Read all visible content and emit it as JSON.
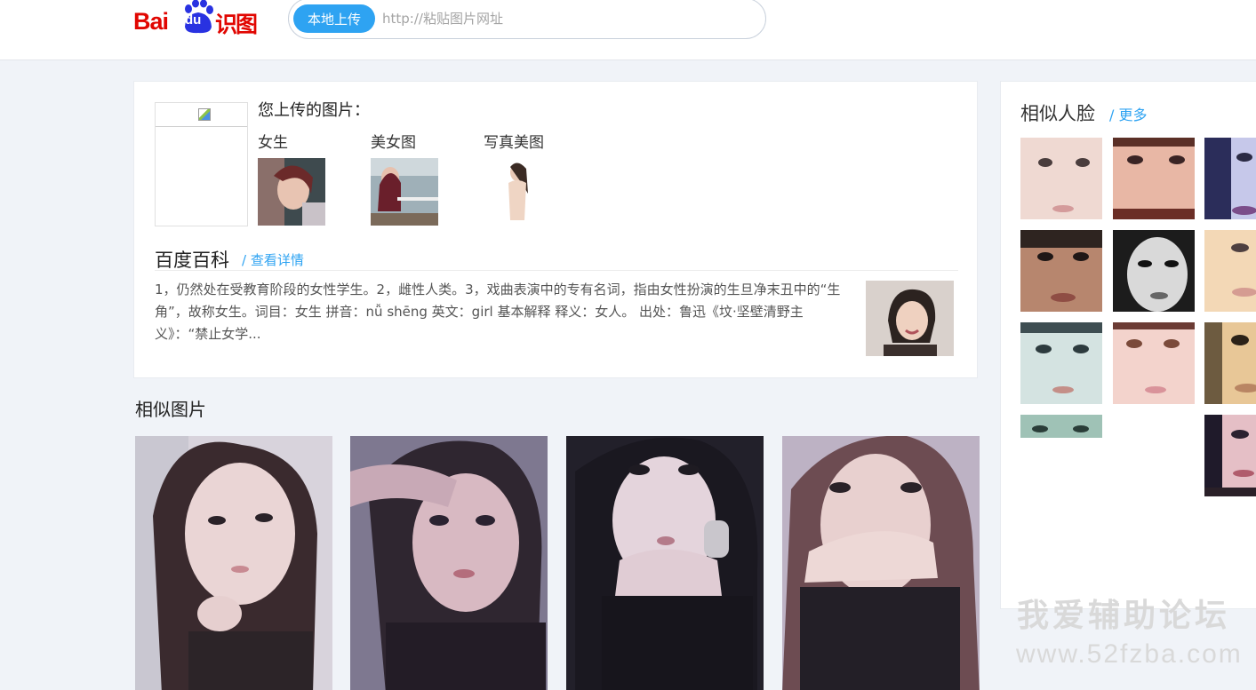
{
  "header": {
    "logo_bai": "Bai",
    "logo_du": "du",
    "logo_shitu": "识图",
    "upload_button": "本地上传",
    "url_placeholder": "http://粘贴图片网址"
  },
  "colors": {
    "accent": "#2ea3f2",
    "brand_red": "#e10601",
    "page_bg": "#f0f3f8"
  },
  "upload": {
    "title": "您上传的图片：",
    "guesses": [
      {
        "label": "女生"
      },
      {
        "label": "美女图"
      },
      {
        "label": "写真美图"
      }
    ]
  },
  "baike": {
    "title": "百度百科",
    "link": "/ 查看详情",
    "text": "1，仍然处在受教育阶段的女性学生。2，雌性人类。3，戏曲表演中的专有名词，指由女性扮演的生旦净末丑中的“生角”，故称女生。词目：女生 拼音：nǚ shēng 英文：girl 基本解释 释义：女人。 出处：鲁迅《坟·坚壁清野主义》：“禁止女学..."
  },
  "similar_images": {
    "title": "相似图片",
    "count": 4
  },
  "similar_faces": {
    "title": "相似人脸",
    "more": "/ 更多",
    "count": 11
  },
  "watermark": {
    "line1": "我爱辅助论坛",
    "line2": "www.52fzba.com"
  }
}
